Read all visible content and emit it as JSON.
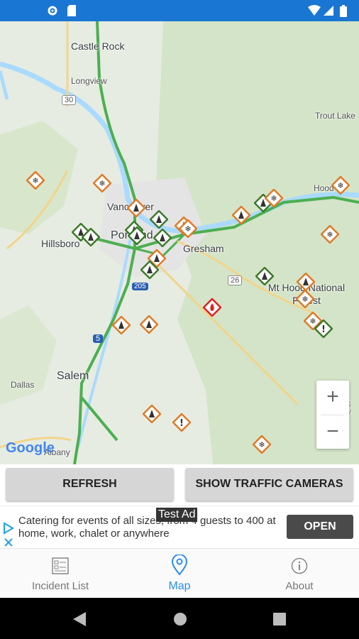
{
  "map": {
    "labels": {
      "castle_rock": "Castle Rock",
      "longview": "Longview",
      "trout_lake": "Trout Lake",
      "hood_river": "Hood Ri",
      "vancouver": "Vancouver",
      "portland": "Portland",
      "hillsboro": "Hillsboro",
      "gresham": "Gresham",
      "mt_hood_forest": "Mt Hood National Forest",
      "salem": "Salem",
      "dallas": "Dallas",
      "albany": "Albany",
      "warm_springs": "WARM S RESERV",
      "hwy_30": "30",
      "hwy_26": "26",
      "hwy_5": "5",
      "hwy_205": "205"
    },
    "zoom_in": "+",
    "zoom_out": "−",
    "attribution": "Google"
  },
  "buttons": {
    "refresh": "REFRESH",
    "cameras": "SHOW TRAFFIC CAMERAS"
  },
  "ad": {
    "badge": "Test Ad",
    "text": "Catering for events of all sizes, from 4 guests to 400 at home, work, chalet or anywhere",
    "cta": "OPEN"
  },
  "nav": {
    "incident_list": "Incident List",
    "map": "Map",
    "about": "About"
  },
  "colors": {
    "status_bar": "#1976d2",
    "active_tab": "#2d8cf0",
    "marker_orange": "#e07b28",
    "marker_green": "#3d7a2a",
    "marker_red": "#e02020"
  }
}
